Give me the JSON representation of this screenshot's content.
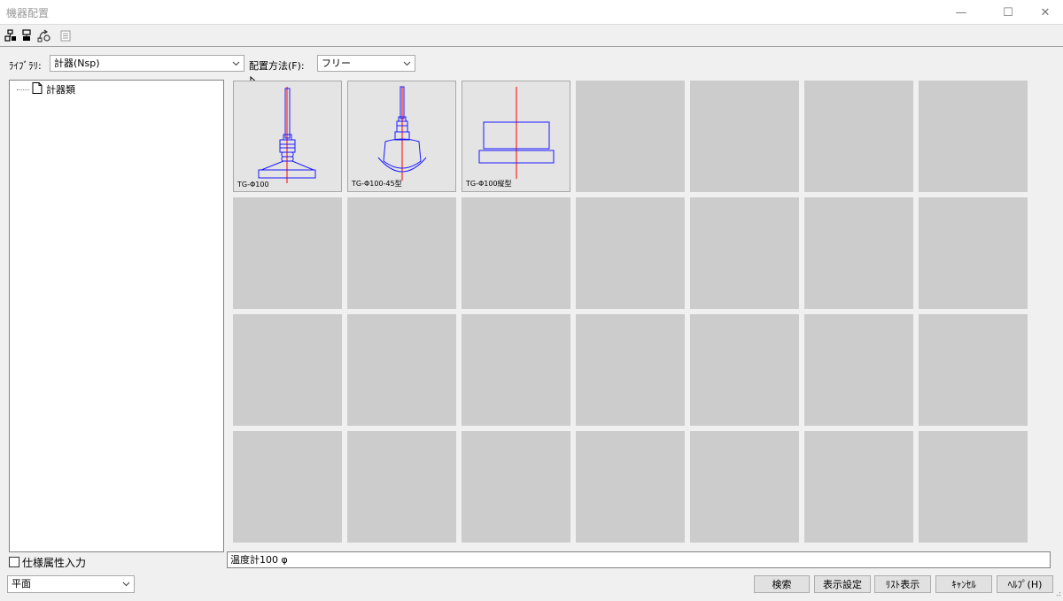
{
  "window": {
    "title": "機器配置",
    "min_glyph": "—",
    "max_glyph": "☐",
    "close_glyph": "✕"
  },
  "toolbar": {
    "icons": [
      "tree-expand-icon",
      "tree-collapse-icon",
      "refresh-link-icon",
      "document-icon"
    ]
  },
  "library": {
    "label": "ﾗｲﾌﾞﾗﾘ:",
    "value": "計器(Nsp)"
  },
  "placement": {
    "label": "配置方法(F):",
    "value": "フリー"
  },
  "tree": {
    "items": [
      {
        "label": "計器類"
      }
    ]
  },
  "grid": {
    "columns": 7,
    "rows": 4,
    "items": [
      {
        "caption": "TG-Φ100",
        "symbol": "gauge-vertical"
      },
      {
        "caption": "TG-Φ100-45型",
        "symbol": "gauge-45"
      },
      {
        "caption": "TG-Φ100縦型",
        "symbol": "gauge-horizontal"
      }
    ]
  },
  "spec_input": {
    "label": "仕様属性入力",
    "checked": false
  },
  "view_select": {
    "value": "平面"
  },
  "status": {
    "text": "温度計100 φ"
  },
  "buttons": {
    "search": "検索",
    "display_settings": "表示設定",
    "list_view": "ﾘｽﾄ表示",
    "cancel": "ｷｬﾝｾﾙ",
    "help": "ﾍﾙﾌﾟ(H)"
  },
  "colors": {
    "symbol_line": "#1a1aff",
    "axis_line": "#ff0000",
    "empty_cell": "#cccccc",
    "filled_cell": "#e4e4e4"
  }
}
